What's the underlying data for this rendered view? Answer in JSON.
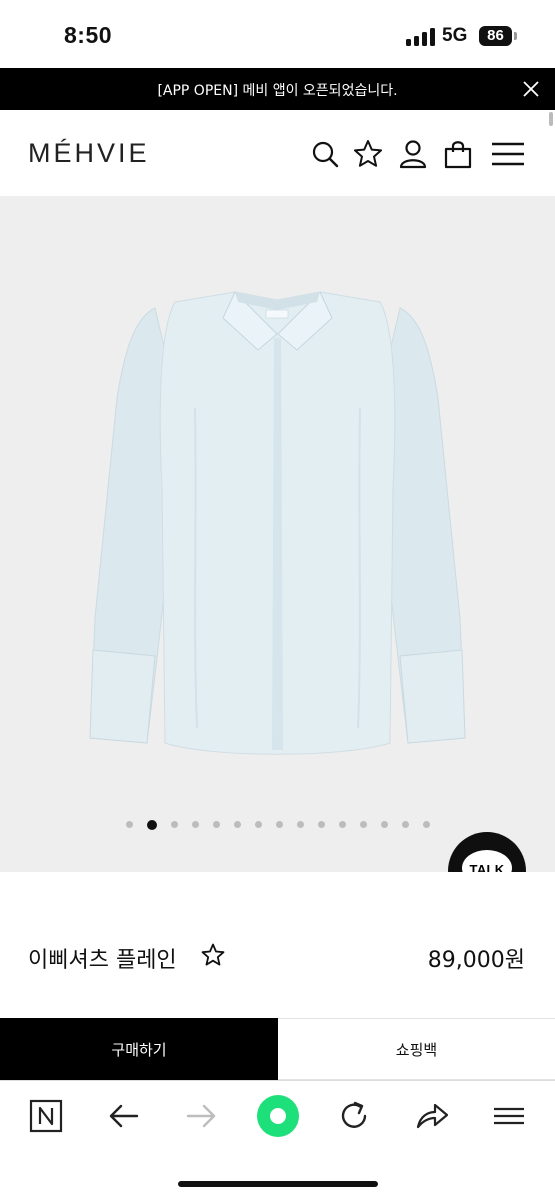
{
  "status_bar": {
    "time": "8:50",
    "network": "5G",
    "battery": "86"
  },
  "banner": {
    "text": "[APP OPEN] 메비 앱이 오픈되었습니다.",
    "close_icon": "close-icon"
  },
  "header": {
    "logo": "MÉHVIE",
    "icons": [
      "search-icon",
      "star-icon",
      "user-icon",
      "bag-icon",
      "menu-icon"
    ]
  },
  "gallery": {
    "total_images": 15,
    "current_index": 2
  },
  "chat_button": {
    "label": "TALK"
  },
  "product": {
    "name": "이삐셔츠 플레인",
    "price": "89,000원"
  },
  "actions": {
    "buy_label": "구매하기",
    "cart_label": "쇼핑백"
  },
  "browser_toolbar": {
    "icons": [
      "naver-n-icon",
      "back-arrow-icon",
      "forward-arrow-icon",
      "green-dot-icon",
      "refresh-icon",
      "share-icon",
      "menu-icon"
    ]
  },
  "colors": {
    "banner_bg": "#000000",
    "gallery_bg": "#eeeeee",
    "buy_bg": "#000000",
    "green_accent": "#1ee07a"
  }
}
